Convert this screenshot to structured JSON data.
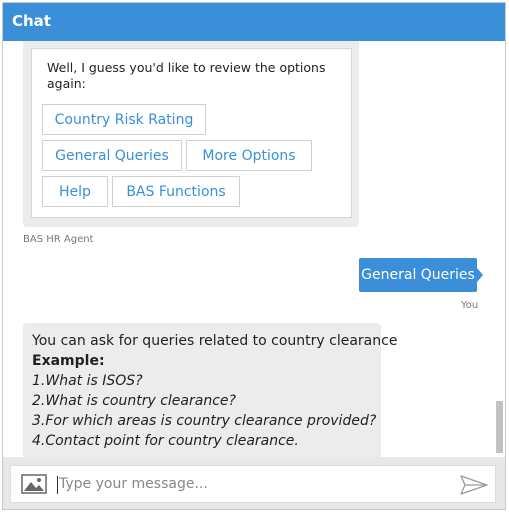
{
  "header": {
    "title": "Chat"
  },
  "messages": {
    "agent_card": {
      "text": "Well, I guess you'd like to review the options again:",
      "buttons": [
        "Country Risk Rating",
        "General Queries",
        "More Options",
        "Help",
        "BAS Functions"
      ]
    },
    "agent_caption": "BAS HR Agent",
    "user_message": "General Queries",
    "user_caption": "You",
    "agent_reply": {
      "intro": "You can ask for queries related to country clearance",
      "example_label": "Example:",
      "items": [
        "1.What is ISOS?",
        "2.What is country clearance?",
        "3.For which areas is country clearance provided?",
        "4.Contact point for country clearance."
      ]
    }
  },
  "composer": {
    "placeholder": "Type your message...",
    "value": ""
  },
  "colors": {
    "accent": "#3a8fd8",
    "bubble_gray": "#ececec"
  },
  "icons": {
    "attach": "image-icon",
    "send": "send-icon"
  }
}
